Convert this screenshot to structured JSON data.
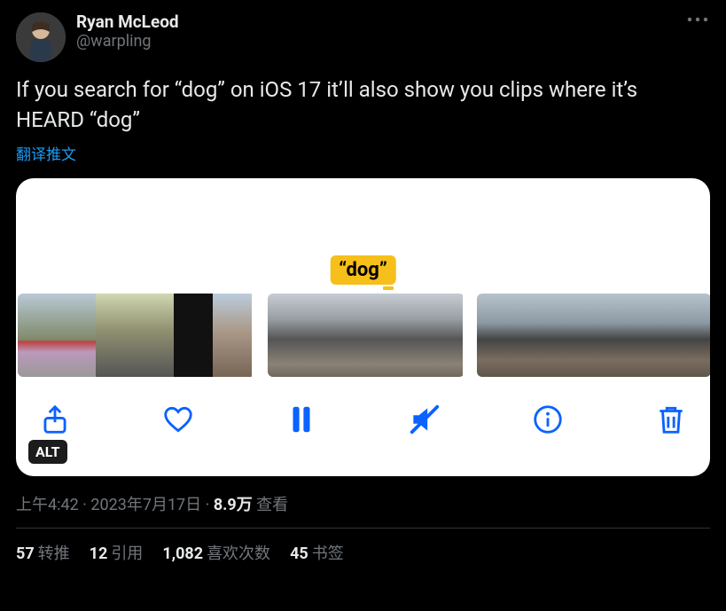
{
  "user": {
    "display_name": "Ryan McLeod",
    "handle": "@warpling"
  },
  "body_text": "If you search for “dog” on iOS 17 it’ll also show you clips where it’s HEARD “dog”",
  "translate_label": "翻译推文",
  "media": {
    "caption_text": "“dog”",
    "alt_badge": "ALT"
  },
  "meta": {
    "time": "上午4:42",
    "sep1": " · ",
    "date": "2023年7月17日",
    "sep2": " · ",
    "views_count": "8.9万",
    "views_label": " 查看"
  },
  "stats": {
    "retweets": {
      "count": "57",
      "label": "转推"
    },
    "quotes": {
      "count": "12",
      "label": "引用"
    },
    "likes": {
      "count": "1,082",
      "label": "喜欢次数"
    },
    "bookmarks": {
      "count": "45",
      "label": "书签"
    }
  }
}
